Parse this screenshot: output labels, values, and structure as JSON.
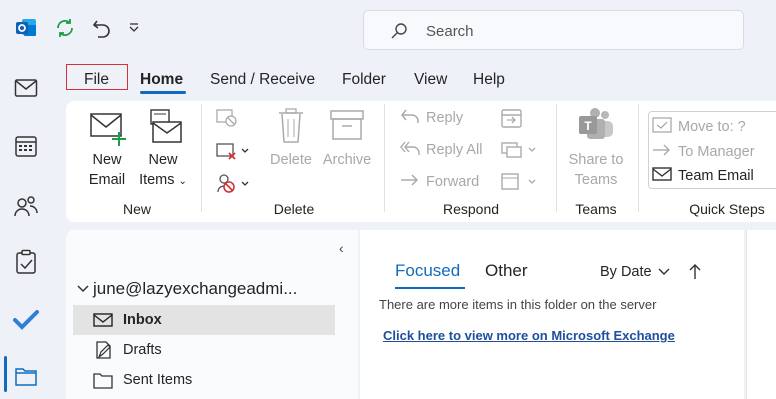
{
  "titlebar": {
    "app_icon": "outlook-icon",
    "sync_icon": "sync-icon",
    "undo_icon": "undo-icon",
    "customize_icon": "customize-qat-icon",
    "search_placeholder": "Search"
  },
  "rail": [
    "mail-icon",
    "calendar-icon",
    "people-icon",
    "tasks-icon",
    "todo-icon",
    "folders-icon"
  ],
  "menu": {
    "file": "File",
    "home": "Home",
    "send_receive": "Send / Receive",
    "folder": "Folder",
    "view": "View",
    "help": "Help"
  },
  "ribbon": {
    "new": {
      "new_email_1": "New",
      "new_email_2": "Email",
      "new_items_1": "New",
      "new_items_2": "Items",
      "group": "New"
    },
    "delete": {
      "delete": "Delete",
      "archive": "Archive",
      "group": "Delete"
    },
    "respond": {
      "reply": "Reply",
      "reply_all": "Reply All",
      "forward": "Forward",
      "group": "Respond"
    },
    "teams": {
      "share_1": "Share to",
      "share_2": "Teams",
      "group": "Teams"
    },
    "quick_steps": {
      "move_to": "Move to: ?",
      "to_manager": "To Manager",
      "team_email": "Team Email",
      "group": "Quick Steps"
    }
  },
  "folders": {
    "account": "june@lazyexchangeadmi...",
    "items": [
      {
        "label": "Inbox",
        "icon": "inbox-icon",
        "selected": true
      },
      {
        "label": "Drafts",
        "icon": "drafts-icon",
        "selected": false
      },
      {
        "label": "Sent Items",
        "icon": "sent-icon",
        "selected": false
      }
    ]
  },
  "list": {
    "tab_focused": "Focused",
    "tab_other": "Other",
    "sort": "By Date",
    "server_notice": "There are more items in this folder on the server",
    "server_link": "Click here to view more on Microsoft Exchange"
  },
  "colors": {
    "accent": "#0f6cbd",
    "highlight": "#d13438",
    "teams": "#5b5fc7"
  }
}
